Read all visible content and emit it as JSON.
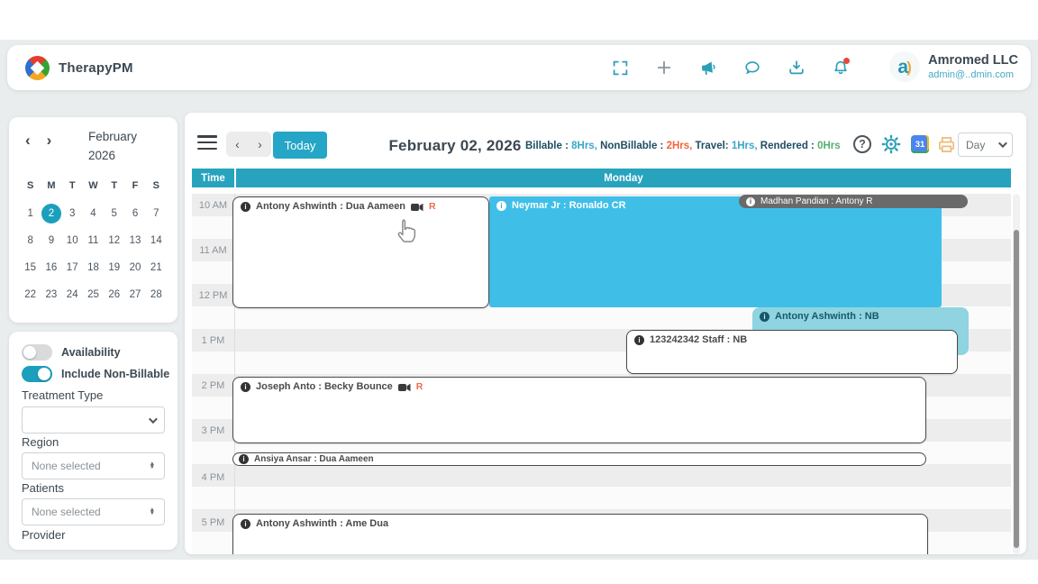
{
  "colors": {
    "accent": "#28a3be",
    "appt_blue": "#3fbfe8",
    "appt_pale": "#8fd4e0",
    "appt_gray": "#6a6a6a",
    "billable_value": "#3aa7c6",
    "nonbillable_value": "#f2633c",
    "travel_value": "#3aa7c6",
    "rendered_value": "#53b06c"
  },
  "header": {
    "app_name": "TherapyPM",
    "company_name": "Amromed LLC",
    "company_email": "admin@..dmin.com"
  },
  "sidebar": {
    "mini_calendar": {
      "month": "February",
      "year": "2026",
      "day_headers": [
        "S",
        "M",
        "T",
        "W",
        "T",
        "F",
        "S"
      ],
      "weeks": [
        [
          "1",
          "2",
          "3",
          "4",
          "5",
          "6",
          "7"
        ],
        [
          "8",
          "9",
          "10",
          "11",
          "12",
          "13",
          "14"
        ],
        [
          "15",
          "16",
          "17",
          "18",
          "19",
          "20",
          "21"
        ],
        [
          "22",
          "23",
          "24",
          "25",
          "26",
          "27",
          "28"
        ]
      ],
      "selected_date": "2"
    },
    "filters": {
      "availability": "Availability",
      "include_non_billable": "Include Non-Billable",
      "treatment_type": "Treatment Type",
      "treatment_type_value": "",
      "region": "Region",
      "region_value": "None selected",
      "patients": "Patients",
      "patients_value": "None selected",
      "provider": "Provider"
    }
  },
  "toolbar": {
    "today": "Today",
    "date_title": "February 02, 2026",
    "stats": {
      "billable_label": "Billable : ",
      "billable_value": "8Hrs, ",
      "nonbillable_label": "NonBillable : ",
      "nonbillable_value": "2Hrs, ",
      "travel_label": "Travel: ",
      "travel_value": "1Hrs, ",
      "rendered_label": "Rendered : ",
      "rendered_value": "0Hrs"
    },
    "view": "Day"
  },
  "grid": {
    "time_header": "Time",
    "day_header": "Monday",
    "time_slots": [
      "10 AM",
      "11 AM",
      "12 PM",
      "1 PM",
      "2 PM",
      "3 PM",
      "4 PM",
      "5 PM"
    ]
  },
  "appointments": {
    "a1": {
      "title": "Antony Ashwinth : Dua Aameen",
      "r": "R"
    },
    "a2": {
      "title": "Neymar Jr : Ronaldo CR"
    },
    "a3": {
      "title": "Madhan Pandian : Antony R"
    },
    "a4": {
      "title": "Antony Ashwinth : NB"
    },
    "a5": {
      "title": "123242342 Staff : NB"
    },
    "a6": {
      "title": "Joseph Anto : Becky Bounce",
      "r": "R"
    },
    "a7": {
      "title": "Ansiya Ansar : Dua Aameen"
    },
    "a8": {
      "title": "Antony Ashwinth : Ame Dua"
    }
  },
  "info_glyph": "i"
}
